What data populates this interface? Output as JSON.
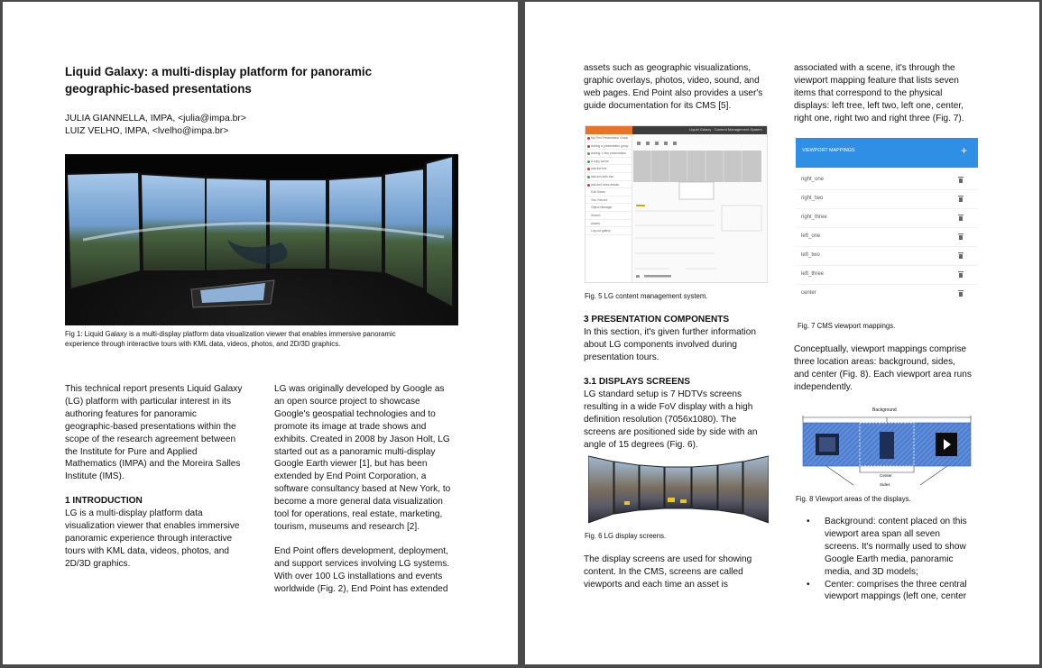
{
  "page1": {
    "title_line1": "Liquid Galaxy: a multi-display platform for panoramic",
    "title_line2": "geographic-based presentations",
    "author1": "JULIA GIANNELLA, IMPA, <julia@impa.br>",
    "author2": "LUIZ VELHO, IMPA, <lvelho@impa.br>",
    "fig1_caption_line1": "Fig 1: Liquid Galaxy is a multi-display platform data visualization viewer that enables immersive panoramic",
    "fig1_caption_line2": "experience through interactive tours with KML data, videos, photos, and 2D/3D graphics.",
    "col1_p1": [
      "This technical report presents Liquid Galaxy",
      "(LG) platform with particular interest in its",
      "authoring features for panoramic",
      "geographic-based presentations within the",
      "scope of the research agreement between",
      "the Institute for Pure and Applied",
      "Mathematics (IMPA) and the Moreira Salles",
      "Institute (IMS)."
    ],
    "intro_heading": "1  INTRODUCTION",
    "col1_p2": [
      "LG is a multi-display platform data",
      "visualization viewer that enables immersive",
      "panoramic experience through interactive",
      "tours with KML data, videos, photos, and",
      "2D/3D graphics."
    ],
    "col2_p1": [
      "LG was originally developed by Google as",
      "an open source project to showcase",
      "Google's geospatial technologies and to",
      "promote its image at trade shows and",
      "exhibits. Created in 2008 by Jason Holt, LG",
      "started out as a panoramic multi-display",
      "Google Earth viewer [1], but has been",
      "extended by End Point Corporation, a",
      "software consultancy based at New York, to",
      "become a more general data visualization",
      "tool for operations, real estate, marketing,",
      "tourism, museums and research [2]."
    ],
    "col2_p2": [
      "End Point offers development, deployment,",
      "and support services involving LG systems.",
      "With over 100 LG installations and events",
      "worldwide (Fig. 2), End Point has extended"
    ]
  },
  "page2": {
    "colA_p1": [
      "assets such as geographic visualizations,",
      "graphic overlays, photos, video, sound, and",
      "web pages. End Point also provides a user's",
      "guide documentation for its CMS [5]."
    ],
    "fig5_caption": "Fig. 5 LG content management system.",
    "sec3_heading": "3  PRESENTATION COMPONENTS",
    "sec3_text": [
      "In this section, it's given further information",
      "about LG components involved during",
      "presentation tours."
    ],
    "sec31_heading": "3.1  DISPLAYS SCREENS",
    "sec31_text": [
      "LG standard setup is 7 HDTVs screens",
      "resulting in a wide FoV display with a high",
      "definition resolution (7056x1080). The",
      "screens are positioned side by side with an",
      "angle of 15 degrees (Fig. 6)."
    ],
    "fig6_caption": "Fig. 6 LG display screens.",
    "colA_p2": [
      "The display screens are used for showing",
      "content. In the CMS, screens are called",
      "viewports and each time an asset is"
    ],
    "colB_p1": [
      "associated with a scene, it's through the",
      "viewport mapping feature that lists seven",
      "items that correspond to the physical",
      "displays: left tree, left two, left one, center,",
      "right one, right two and right three (Fig. 7)."
    ],
    "viewport_header": "VIEWPORT MAPPINGS",
    "viewport_add": "+",
    "viewport_rows": [
      "right_one",
      "right_two",
      "right_three",
      "left_one",
      "left_two",
      "left_three",
      "center"
    ],
    "fig7_caption": "Fig. 7 CMS viewport mappings.",
    "colB_p2": [
      "Conceptually, viewport mappings comprise",
      "three location areas: background, sides,",
      "and center (Fig. 8). Each viewport area runs",
      "independently."
    ],
    "fig8_label_background": "Background",
    "fig8_label_center": "Center",
    "fig8_label_sides": "Sides",
    "fig8_caption": "Fig. 8 Viewport areas of the displays.",
    "bullet1": [
      "Background: content placed on this",
      "viewport area span all seven",
      "screens. It's normally used to show",
      "Google Earth media, panoramic",
      "media, and 3D models;"
    ],
    "bullet2": [
      "Center: comprises the three central",
      "viewport mappings (left one, center"
    ]
  },
  "cms_mock": {
    "header_title": "Liquid Galaxy · Content Management System",
    "sidebar": [
      "My First Presentation Group",
      "Adding a presentation group",
      "Adding 1 new presentation",
      "A copy scene",
      "add-the-kml",
      "add-kml-with-tour",
      "add-kml-more-details",
      "Edit Scene",
      "Tour Record",
      "Object Manager",
      "Search",
      "Assets",
      "Log out gallery"
    ]
  },
  "colors": {
    "background": "#4a4a4a",
    "page": "#ffffff",
    "viewport_header": "#2f8fe4",
    "fig8_blue": "#4f7fd0",
    "cms_orange": "#e8742b"
  }
}
